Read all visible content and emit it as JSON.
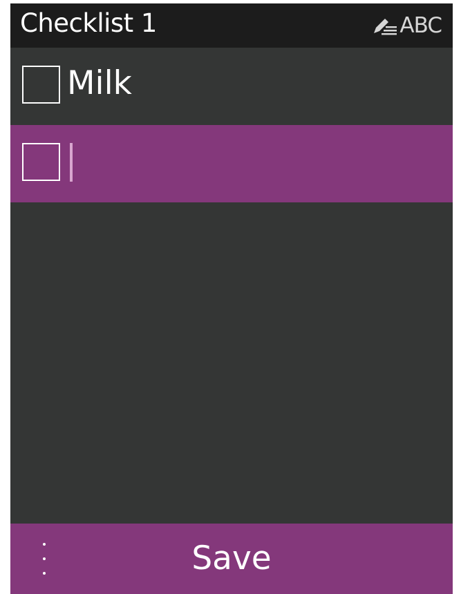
{
  "header": {
    "title": "Checklist 1",
    "input_mode": {
      "icon": "pen-icon",
      "label": "ABC"
    }
  },
  "checklist": {
    "items": [
      {
        "label": "Milk",
        "checked": false,
        "selected": false
      },
      {
        "label": "",
        "checked": false,
        "selected": true,
        "editing": true
      }
    ]
  },
  "footer": {
    "menu_icon": "more-options-icon",
    "save_label": "Save"
  },
  "colors": {
    "accent": "#84387b",
    "background": "#343635",
    "header_background": "#1c1c1c",
    "text": "#ffffff",
    "caret": "#d8a6cf"
  }
}
